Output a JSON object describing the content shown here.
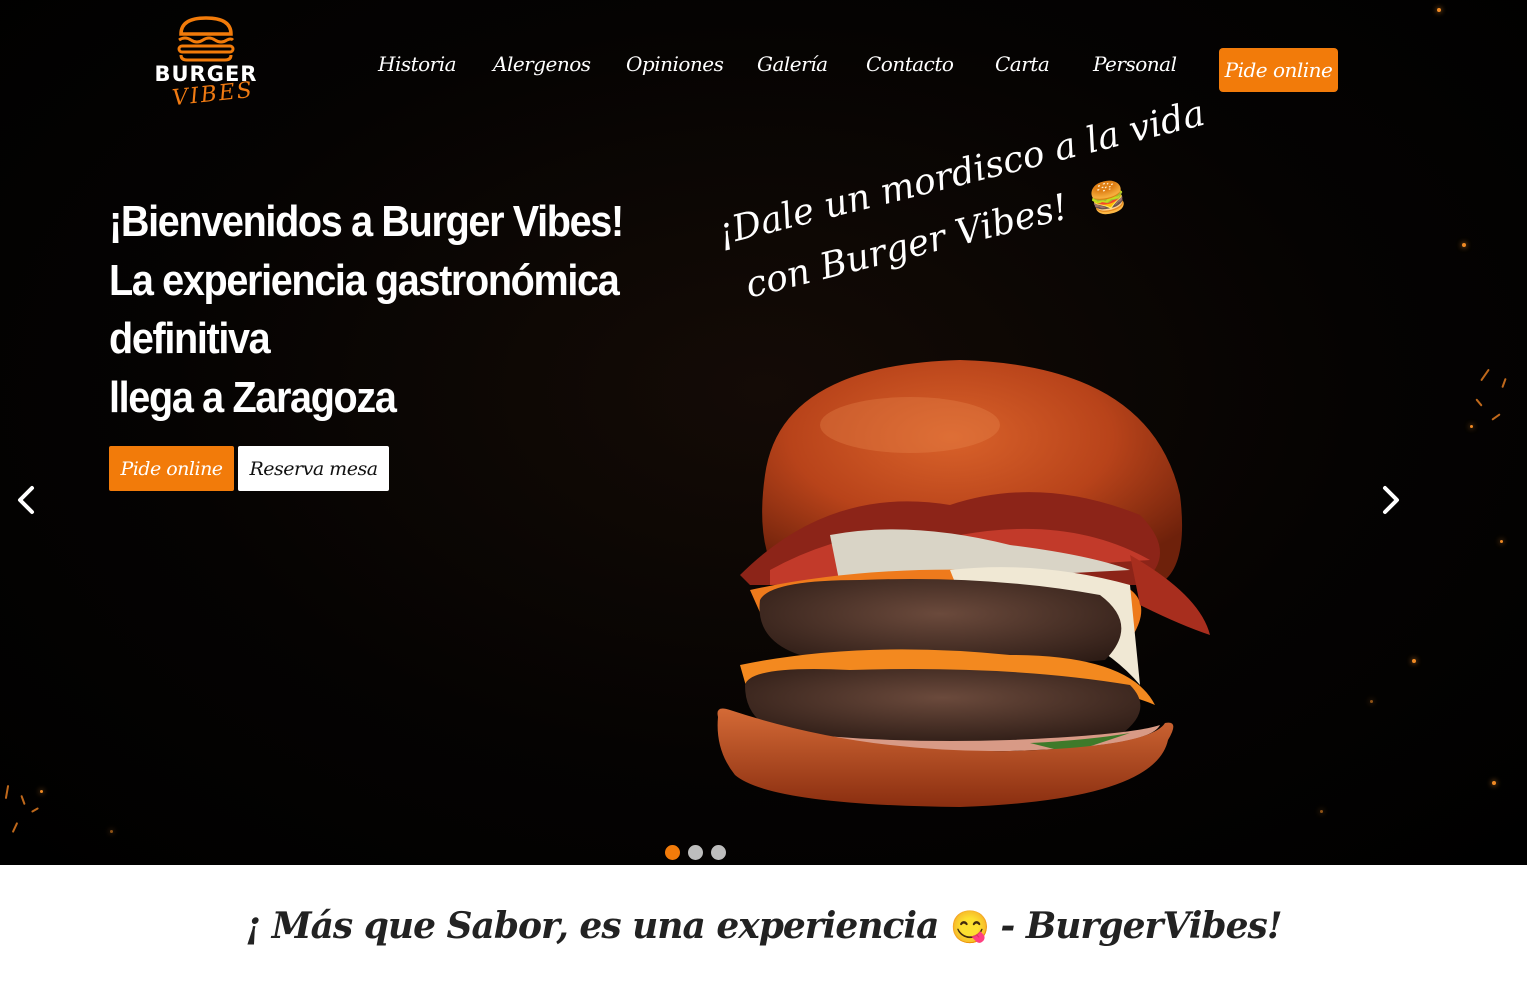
{
  "brand": {
    "name_top": "BURGER",
    "name_bottom": "VIBES",
    "accent_color": "#f27b0a"
  },
  "nav": {
    "links": [
      "Historia",
      "Alergenos",
      "Opiniones",
      "Galería",
      "Contacto",
      "Carta",
      "Personal"
    ],
    "cta_label": "Pide online"
  },
  "hero": {
    "title_lines": [
      "¡Bienvenidos a Burger Vibes!",
      "La experiencia gastronómica",
      "definitiva",
      "llega a Zaragoza"
    ],
    "buttons": {
      "order_label": "Pide online",
      "reserve_label": "Reserva mesa"
    },
    "tagline_line1": "¡Dale un mordisco a la vida",
    "tagline_line2": "con Burger Vibes!",
    "tagline_emoji": "🍔",
    "image_icon": "burger-photo",
    "prev_icon": "chevron-left-icon",
    "next_icon": "chevron-right-icon"
  },
  "carousel": {
    "slides": 3,
    "active_index": 0
  },
  "slogan": {
    "text_before": "¡ Más que Sabor, es una experiencia",
    "emoji": "😋",
    "text_after": " -  BurgerVibes!"
  }
}
